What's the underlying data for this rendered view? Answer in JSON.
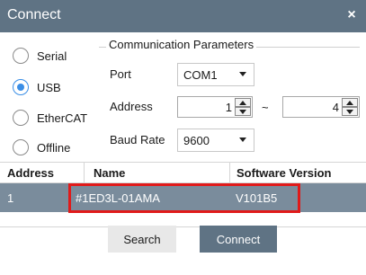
{
  "window": {
    "title": "Connect",
    "close_glyph": "×"
  },
  "connection_types": [
    {
      "label": "Serial",
      "checked": false
    },
    {
      "label": "USB",
      "checked": true
    },
    {
      "label": "EtherCAT",
      "checked": false
    },
    {
      "label": "Offline",
      "checked": false
    }
  ],
  "params": {
    "group_title": "Communication Parameters",
    "port_label": "Port",
    "port_value": "COM1",
    "address_label": "Address",
    "address_from": "1",
    "address_separator": "~",
    "address_to": "4",
    "baud_label": "Baud Rate",
    "baud_value": "9600"
  },
  "table": {
    "columns": [
      "Address",
      "Name",
      "Software Version"
    ],
    "rows": [
      {
        "address": "1",
        "name": "#1ED3L-01AMA",
        "version": "V101B5"
      }
    ]
  },
  "buttons": {
    "search": "Search",
    "connect": "Connect"
  },
  "colors": {
    "titlebar": "#5f7384",
    "selected_row": "#7a8c9c",
    "highlight": "#e01a1a",
    "radio_accent": "#3a8ee6"
  }
}
